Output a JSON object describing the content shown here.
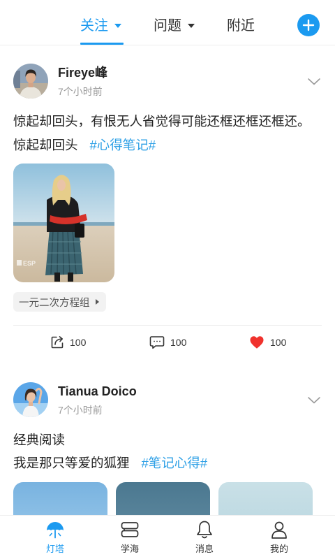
{
  "top_tabs": [
    {
      "label": "关注",
      "dropdown": true,
      "active": true
    },
    {
      "label": "问题",
      "dropdown": true,
      "active": false
    },
    {
      "label": "附近",
      "dropdown": false,
      "active": false
    }
  ],
  "add_button": {
    "icon": "plus-icon"
  },
  "posts": [
    {
      "author": "Fireye峰",
      "time": "7个小时前",
      "text_lines": [
        "惊起却回头，有恨无人省觉得可能还框还框还框还。",
        "惊起却回头"
      ],
      "hashtag": "#心得笔记#",
      "image_watermark": "ESP",
      "topic_tag": "一元二次方程组",
      "actions": [
        {
          "icon": "share-icon",
          "count": "100"
        },
        {
          "icon": "comment-icon",
          "count": "100"
        },
        {
          "icon": "heart-icon",
          "count": "100",
          "liked": true
        }
      ]
    },
    {
      "author": "Tianua Doico",
      "time": "7个小时前",
      "text_lines": [
        "经典阅读",
        "我是那只等爱的狐狸"
      ],
      "hashtag": "#笔记心得#"
    }
  ],
  "bottom_nav": [
    {
      "label": "灯塔",
      "icon": "lighthouse-icon",
      "active": true
    },
    {
      "label": "学海",
      "icon": "books-icon",
      "active": false
    },
    {
      "label": "消息",
      "icon": "bell-icon",
      "active": false
    },
    {
      "label": "我的",
      "icon": "user-icon",
      "active": false
    }
  ],
  "colors": {
    "accent": "#1b9af0",
    "hashtag": "#2ea0e6",
    "like_heart": "#f0322d",
    "muted_text": "#999999",
    "body_text": "#222222"
  }
}
